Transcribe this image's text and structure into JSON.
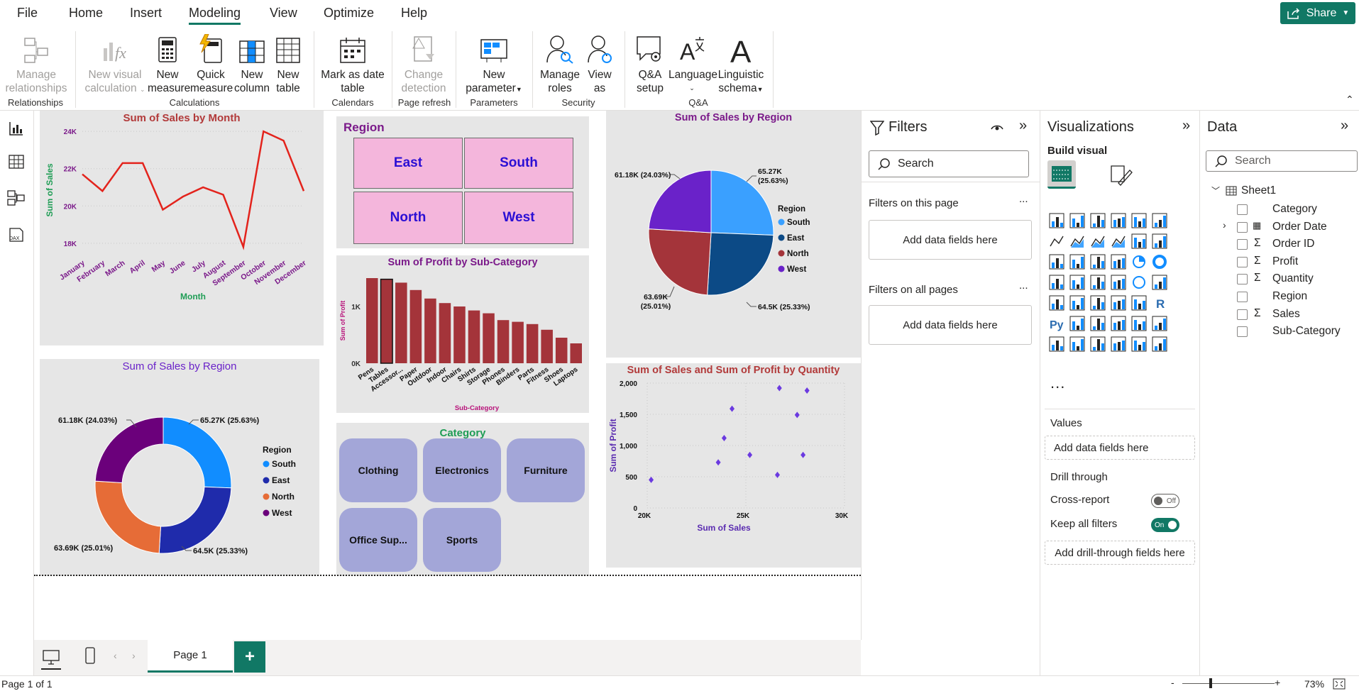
{
  "menu": {
    "file": "File",
    "home": "Home",
    "insert": "Insert",
    "modeling": "Modeling",
    "view": "View",
    "optimize": "Optimize",
    "help": "Help",
    "share": "Share"
  },
  "ribbon": {
    "manage_relationships": [
      "Manage",
      "relationships"
    ],
    "new_visual_calc": [
      "New visual",
      "calculation"
    ],
    "new_measure": [
      "New",
      "measure"
    ],
    "quick_measure": [
      "Quick",
      "measure"
    ],
    "new_column": [
      "New",
      "column"
    ],
    "new_table": [
      "New",
      "table"
    ],
    "mark_date_table": [
      "Mark as date",
      "table"
    ],
    "change_detection": [
      "Change",
      "detection"
    ],
    "new_parameter": [
      "New",
      "parameter"
    ],
    "manage_roles": [
      "Manage",
      "roles"
    ],
    "view_as": [
      "View",
      "as"
    ],
    "qa_setup": [
      "Q&A",
      "setup"
    ],
    "language": [
      "Language",
      ""
    ],
    "linguistic_schema": [
      "Linguistic",
      "schema"
    ],
    "groups": {
      "relationships": "Relationships",
      "calculations": "Calculations",
      "calendars": "Calendars",
      "page_refresh": "Page refresh",
      "parameters": "Parameters",
      "security": "Security",
      "qa": "Q&A"
    }
  },
  "colors": {
    "accent": "#117865",
    "south": "#3aa0ff",
    "east": "#0c4a86",
    "north_pie": "#a4343a",
    "west": "#6a22c9",
    "donut_south": "#118dff",
    "donut_east": "#1f2bab",
    "donut_north": "#e66c37",
    "donut_west": "#6b007b",
    "line": "#e3231c",
    "bar": "#a4343a",
    "scatter": "#6b3ae0"
  },
  "line_chart": {
    "title": "Sum of Sales by Month",
    "xlabel": "Month",
    "ylabel": "Sum of Sales",
    "yticks": [
      "24K",
      "22K",
      "20K",
      "18K"
    ]
  },
  "region_slicer": {
    "title": "Region",
    "items": [
      "East",
      "South",
      "North",
      "West"
    ]
  },
  "bar_chart": {
    "title": "Sum of Profit by Sub-Category",
    "xlabel": "Sub-Category",
    "ylabel": "Sum of Profit",
    "yticks": [
      "1K",
      "0K"
    ]
  },
  "pie_chart": {
    "title": "Sum of Sales by Region",
    "legend_title": "Region",
    "labels": {
      "south": [
        "65.27K",
        "(25.63%)"
      ],
      "east": "64.5K (25.33%)",
      "north": [
        "63.69K",
        "(25.01%)"
      ],
      "west": "61.18K (24.03%)"
    }
  },
  "donut_chart": {
    "title": "Sum of Sales by Region",
    "legend_title": "Region",
    "labels": {
      "south": "65.27K (25.63%)",
      "east": "64.5K (25.33%)",
      "north": "63.69K (25.01%)",
      "west": "61.18K (24.03%)"
    }
  },
  "category_slicer": {
    "title": "Category",
    "items": [
      "Clothing",
      "Electronics",
      "Furniture",
      "Office Sup...",
      "Sports"
    ]
  },
  "scatter_chart": {
    "title": "Sum of Sales and Sum of Profit by Quantity",
    "xlabel": "Sum of Sales",
    "ylabel": "Sum of Profit",
    "xticks": [
      "20K",
      "25K",
      "30K"
    ],
    "yticks": [
      "2,000",
      "1,500",
      "1,000",
      "500",
      "0"
    ]
  },
  "chart_data": [
    {
      "type": "line",
      "title": "Sum of Sales by Month",
      "xlabel": "Month",
      "ylabel": "Sum of Sales",
      "categories": [
        "January",
        "February",
        "March",
        "April",
        "May",
        "June",
        "July",
        "August",
        "September",
        "October",
        "November",
        "December"
      ],
      "values": [
        21700,
        20800,
        22300,
        22300,
        19800,
        20500,
        21000,
        20600,
        17800,
        24000,
        23500,
        20800
      ],
      "ylim": [
        17500,
        24500
      ]
    },
    {
      "type": "bar",
      "title": "Sum of Profit by Sub-Category",
      "xlabel": "Sub-Category",
      "ylabel": "Sum of Profit",
      "categories": [
        "Pens",
        "Tables",
        "Accessor...",
        "Paper",
        "Outdoor",
        "Indoor",
        "Chairs",
        "Shirts",
        "Storage",
        "Phones",
        "Binders",
        "Parts",
        "Fitness",
        "Shoes",
        "Laptops"
      ],
      "values": [
        1500,
        1480,
        1420,
        1290,
        1140,
        1060,
        1000,
        930,
        880,
        760,
        730,
        690,
        590,
        450,
        350
      ],
      "ylim": [
        0,
        1600
      ]
    },
    {
      "type": "pie",
      "title": "Sum of Sales by Region",
      "categories": [
        "South",
        "East",
        "North",
        "West"
      ],
      "values": [
        65270,
        64500,
        63690,
        61180
      ]
    },
    {
      "type": "pie",
      "title": "Sum of Sales by Region",
      "categories": [
        "South",
        "East",
        "North",
        "West"
      ],
      "values": [
        65270,
        64500,
        63690,
        61180
      ]
    },
    {
      "type": "scatter",
      "title": "Sum of Sales and Sum of Profit by Quantity",
      "xlabel": "Sum of Sales",
      "ylabel": "Sum of Profit",
      "x": [
        20200,
        23600,
        23900,
        24300,
        25200,
        26600,
        26700,
        27600,
        27900,
        28100
      ],
      "y": [
        450,
        730,
        1120,
        1590,
        850,
        530,
        1920,
        1490,
        850,
        1880
      ],
      "xlim": [
        20000,
        30000
      ],
      "ylim": [
        0,
        2000
      ]
    }
  ],
  "filters": {
    "title": "Filters",
    "search": "Search",
    "on_page": "Filters on this page",
    "on_all": "Filters on all pages",
    "add": "Add data fields here",
    "more": "..."
  },
  "viz": {
    "title": "Visualizations",
    "build": "Build visual",
    "values": "Values",
    "add": "Add data fields here",
    "drill": "Drill through",
    "cross": "Cross-report",
    "cross_state": "Off",
    "keep": "Keep all filters",
    "keep_state": "On",
    "add_drill": "Add drill-through fields here",
    "more": "..."
  },
  "data": {
    "title": "Data",
    "search": "Search",
    "table": "Sheet1",
    "fields": [
      {
        "name": "Category",
        "sigma": false,
        "expand": false,
        "cal": false
      },
      {
        "name": "Order Date",
        "sigma": false,
        "expand": true,
        "cal": true
      },
      {
        "name": "Order ID",
        "sigma": true,
        "expand": false,
        "cal": false
      },
      {
        "name": "Profit",
        "sigma": true,
        "expand": false,
        "cal": false
      },
      {
        "name": "Quantity",
        "sigma": true,
        "expand": false,
        "cal": false
      },
      {
        "name": "Region",
        "sigma": false,
        "expand": false,
        "cal": false
      },
      {
        "name": "Sales",
        "sigma": true,
        "expand": false,
        "cal": false
      },
      {
        "name": "Sub-Category",
        "sigma": false,
        "expand": false,
        "cal": false
      }
    ]
  },
  "tabs": {
    "page1": "Page 1",
    "add": "+"
  },
  "status": {
    "page": "Page 1 of 1",
    "zoom": "73%",
    "minus": "-",
    "plus": "+"
  }
}
